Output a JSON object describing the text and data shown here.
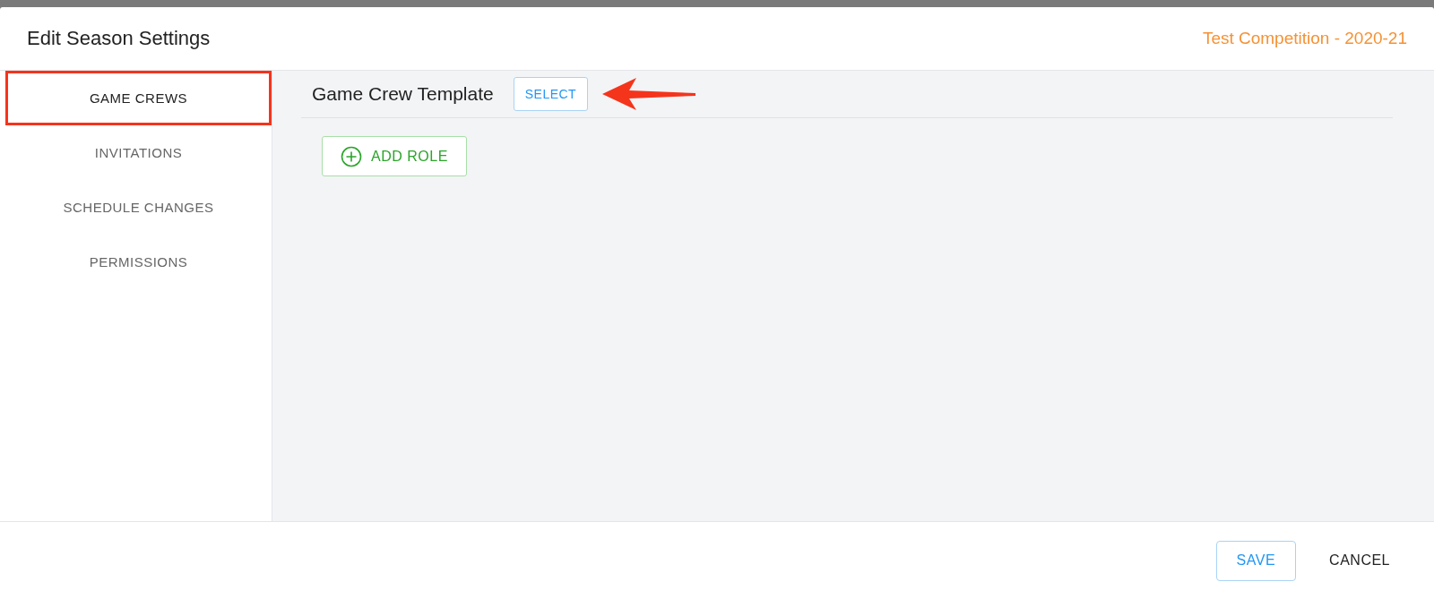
{
  "dialog": {
    "title": "Edit Season Settings",
    "subtitle": "Test Competition - 2020-21"
  },
  "tabs": [
    {
      "label": "GAME CREWS",
      "selected": true
    },
    {
      "label": "INVITATIONS",
      "selected": false
    },
    {
      "label": "SCHEDULE CHANGES",
      "selected": false
    },
    {
      "label": "PERMISSIONS",
      "selected": false
    }
  ],
  "section": {
    "title": "Game Crew Template",
    "select_button": "SELECT",
    "add_button": "ADD ROLE"
  },
  "footer": {
    "buttons": [
      {
        "label": "SAVE",
        "kind": "outlined"
      },
      {
        "label": "CANCEL",
        "kind": "text"
      }
    ]
  }
}
